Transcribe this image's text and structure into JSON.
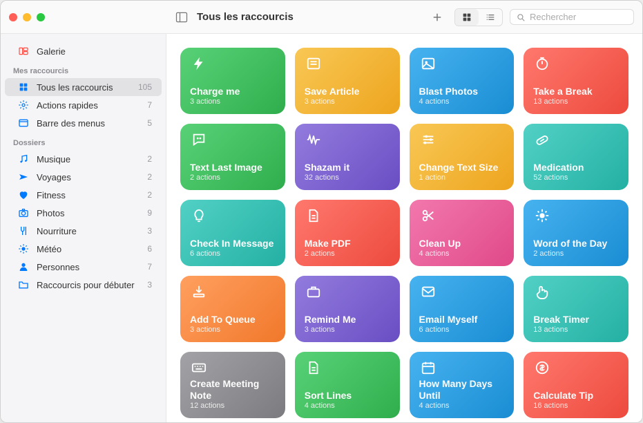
{
  "header": {
    "title": "Tous les raccourcis",
    "search_placeholder": "Rechercher"
  },
  "sidebar": {
    "gallery_label": "Galerie",
    "groups": [
      {
        "title": "Mes raccourcis",
        "items": [
          {
            "icon": "grid",
            "label": "Tous les raccourcis",
            "count": 105,
            "selected": true
          },
          {
            "icon": "gear",
            "label": "Actions rapides",
            "count": 7
          },
          {
            "icon": "menubar",
            "label": "Barre des menus",
            "count": 5
          }
        ]
      },
      {
        "title": "Dossiers",
        "items": [
          {
            "icon": "music",
            "label": "Musique",
            "count": 2
          },
          {
            "icon": "plane",
            "label": "Voyages",
            "count": 2
          },
          {
            "icon": "heart",
            "label": "Fitness",
            "count": 2
          },
          {
            "icon": "camera",
            "label": "Photos",
            "count": 9
          },
          {
            "icon": "fork",
            "label": "Nourriture",
            "count": 3
          },
          {
            "icon": "sun",
            "label": "Météo",
            "count": 6
          },
          {
            "icon": "person",
            "label": "Personnes",
            "count": 7
          },
          {
            "icon": "folder",
            "label": "Raccourcis pour débuter",
            "count": 3
          }
        ]
      }
    ]
  },
  "shortcuts": [
    {
      "title": "Charge me",
      "sub": "3 actions",
      "color": "c-green",
      "icon": "bolt"
    },
    {
      "title": "Save Article",
      "sub": "3 actions",
      "color": "c-yellow",
      "icon": "news"
    },
    {
      "title": "Blast Photos",
      "sub": "4 actions",
      "color": "c-blue",
      "icon": "picture"
    },
    {
      "title": "Take a Break",
      "sub": "13 actions",
      "color": "c-red",
      "icon": "timer"
    },
    {
      "title": "Text Last Image",
      "sub": "2 actions",
      "color": "c-green",
      "icon": "bubble"
    },
    {
      "title": "Shazam it",
      "sub": "32 actions",
      "color": "c-purple",
      "icon": "wave"
    },
    {
      "title": "Change Text Size",
      "sub": "1 action",
      "color": "c-yellow",
      "icon": "sliders"
    },
    {
      "title": "Medication",
      "sub": "52 actions",
      "color": "c-teal",
      "icon": "pill"
    },
    {
      "title": "Check In Message",
      "sub": "6 actions",
      "color": "c-teal",
      "icon": "bulb"
    },
    {
      "title": "Make PDF",
      "sub": "2 actions",
      "color": "c-red",
      "icon": "doc"
    },
    {
      "title": "Clean Up",
      "sub": "4 actions",
      "color": "c-pink",
      "icon": "scissors"
    },
    {
      "title": "Word of the Day",
      "sub": "2 actions",
      "color": "c-blue",
      "icon": "sparkle"
    },
    {
      "title": "Add To Queue",
      "sub": "3 actions",
      "color": "c-orange",
      "icon": "arrowdown"
    },
    {
      "title": "Remind Me",
      "sub": "3 actions",
      "color": "c-purple",
      "icon": "briefcase"
    },
    {
      "title": "Email Myself",
      "sub": "6 actions",
      "color": "c-blue",
      "icon": "mail"
    },
    {
      "title": "Break Timer",
      "sub": "13 actions",
      "color": "c-teal",
      "icon": "hand"
    },
    {
      "title": "Create Meeting Note",
      "sub": "12 actions",
      "color": "c-grey",
      "icon": "keyboard"
    },
    {
      "title": "Sort Lines",
      "sub": "4 actions",
      "color": "c-green",
      "icon": "doc"
    },
    {
      "title": "How Many Days Until",
      "sub": "4 actions",
      "color": "c-blue",
      "icon": "calendar"
    },
    {
      "title": "Calculate Tip",
      "sub": "16 actions",
      "color": "c-red",
      "icon": "dollar"
    }
  ]
}
